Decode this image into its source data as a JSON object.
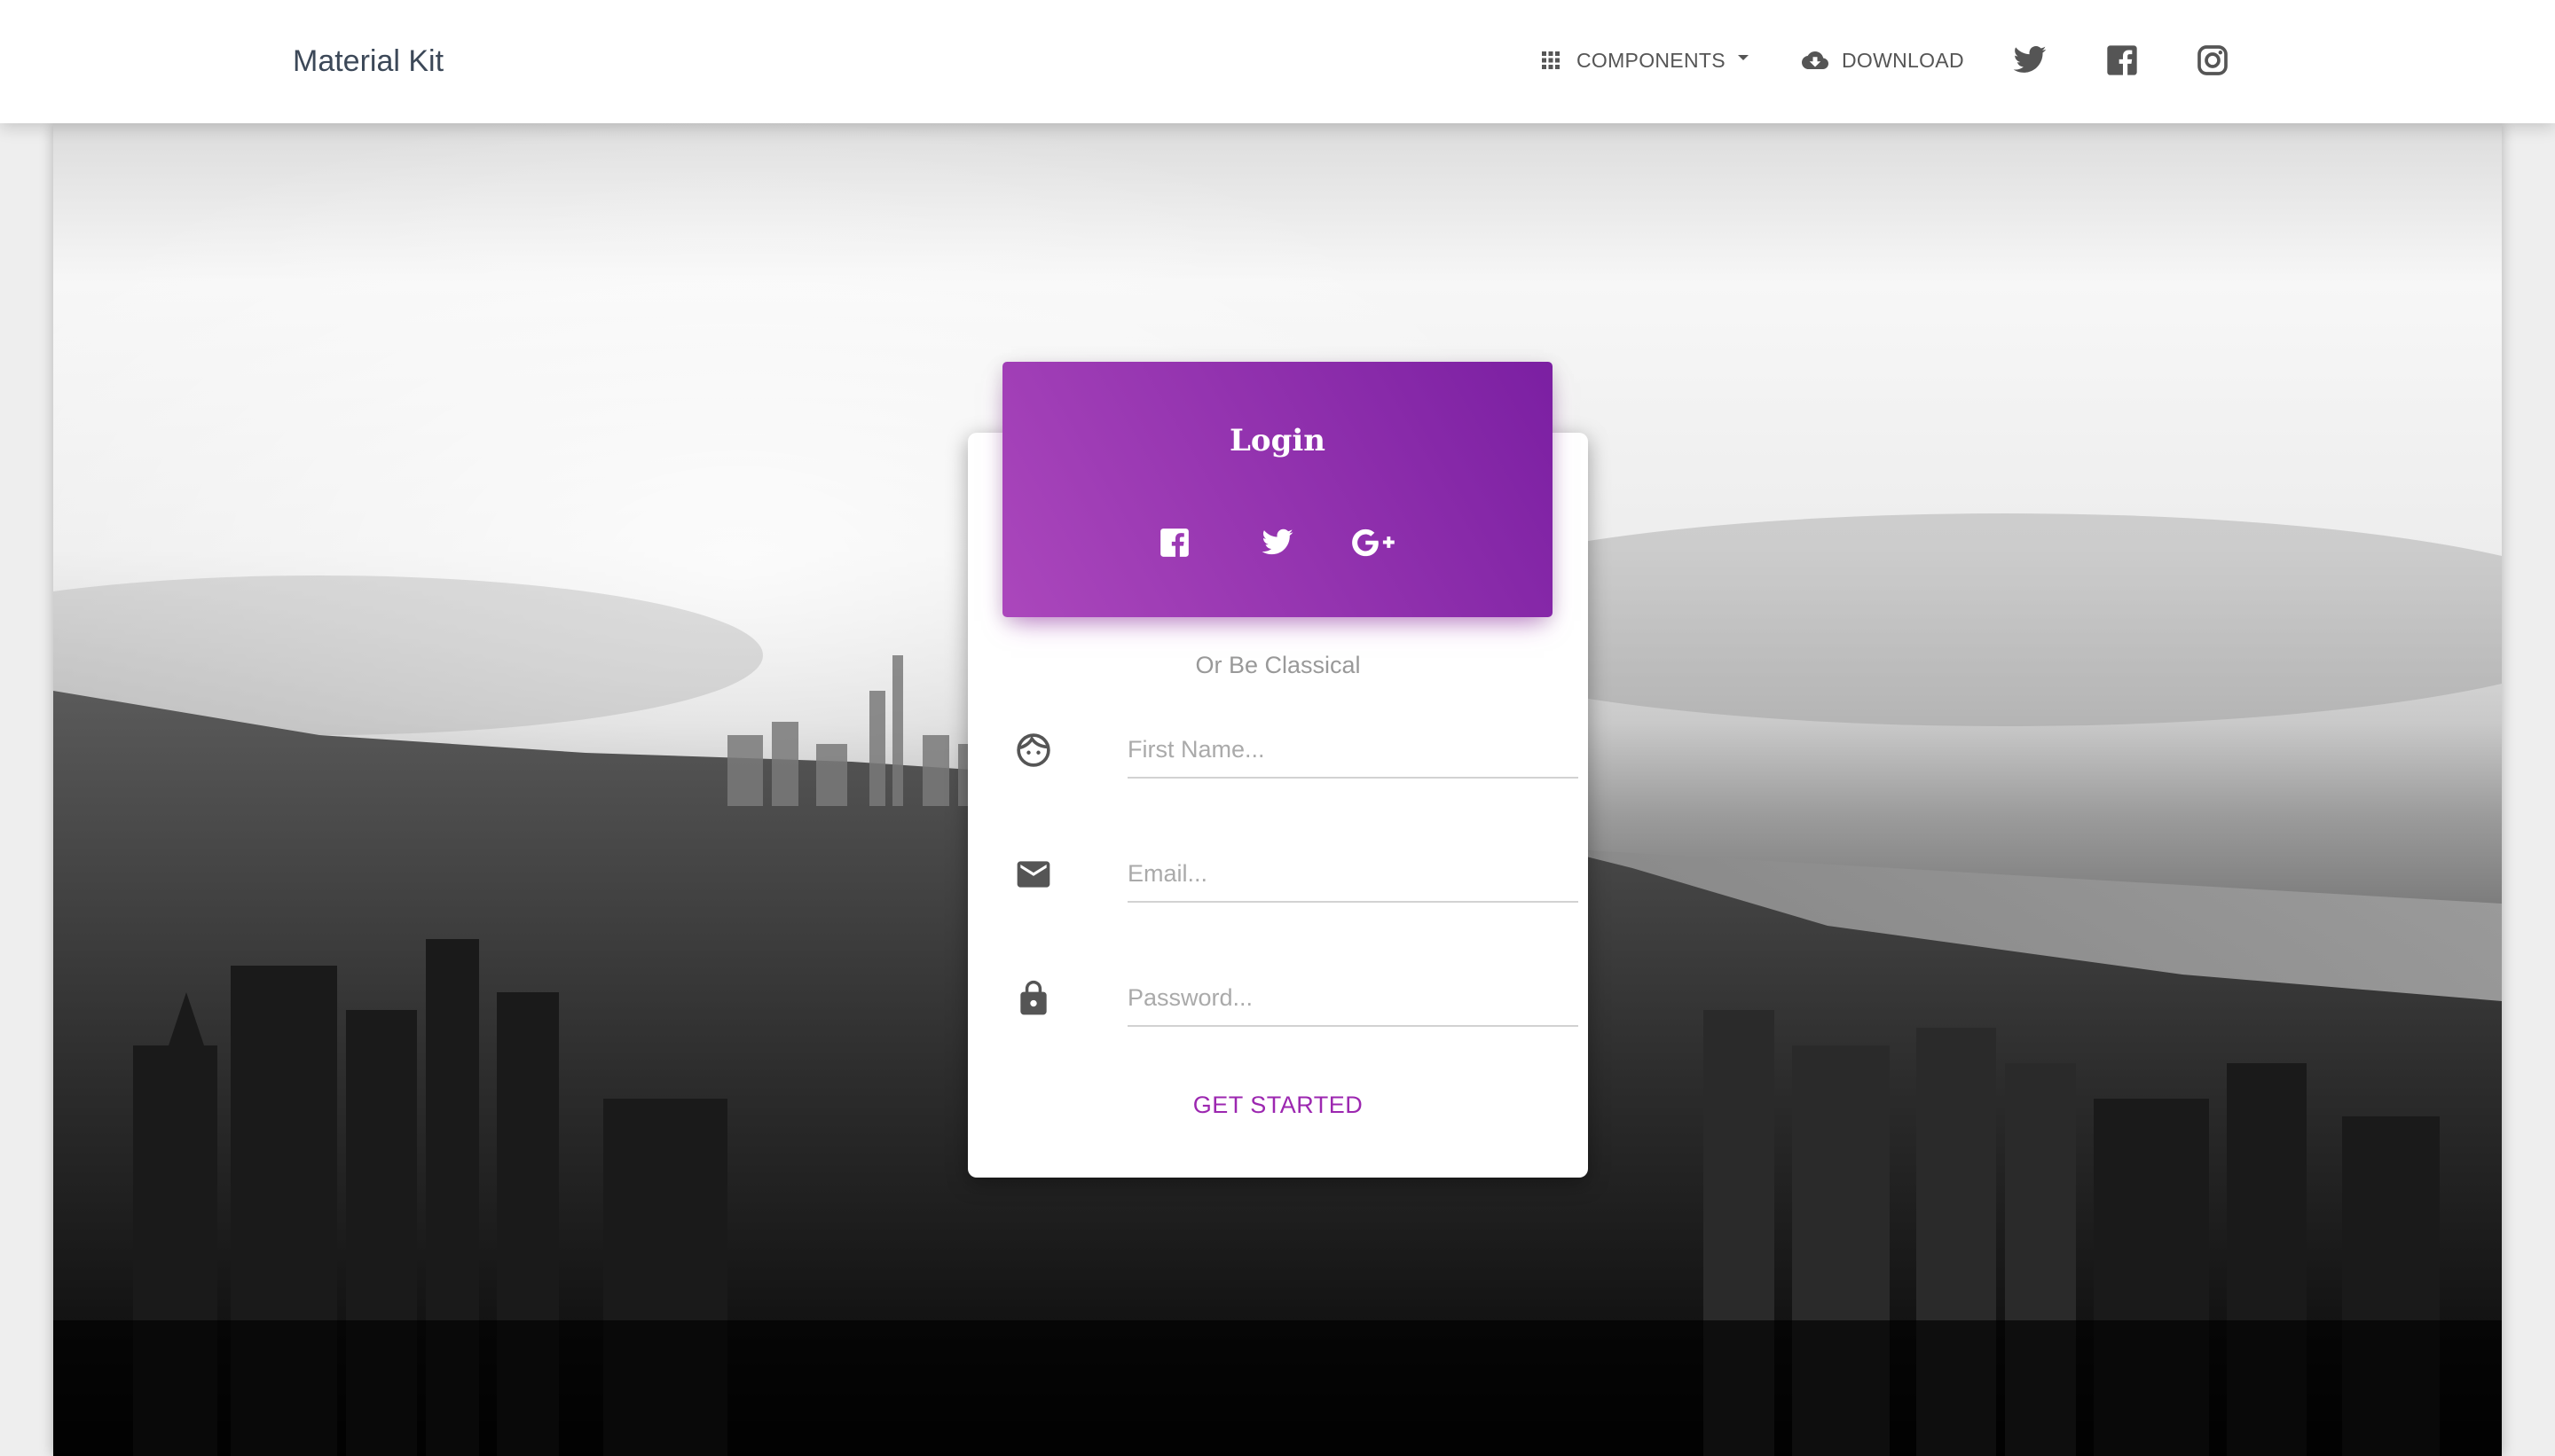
{
  "navbar": {
    "brand": "Material Kit",
    "components_label": "COMPONENTS",
    "download_label": "DOWNLOAD",
    "icons": [
      "apps-icon",
      "caret-down-icon",
      "cloud-download-icon",
      "twitter-icon",
      "facebook-icon",
      "instagram-icon"
    ]
  },
  "login_card": {
    "title": "Login",
    "social_icons": [
      "facebook-icon",
      "twitter-icon",
      "google-plus-icon"
    ],
    "divider_text": "Or Be Classical",
    "fields": [
      {
        "name": "first-name",
        "icon": "face-icon",
        "placeholder": "First Name...",
        "value": ""
      },
      {
        "name": "email",
        "icon": "mail-icon",
        "placeholder": "Email...",
        "value": ""
      },
      {
        "name": "password",
        "icon": "lock-icon",
        "placeholder": "Password...",
        "value": ""
      }
    ],
    "cta_label": "GET STARTED"
  },
  "colors": {
    "primary": "#9c27b0",
    "header_gradient_start": "#ab47bc",
    "header_gradient_end": "#7b1fa2",
    "nav_text": "#555555",
    "brand_text": "#3c4858"
  },
  "background": "Grayscale aerial photograph of a city skyline with a river under a cloudy sky"
}
